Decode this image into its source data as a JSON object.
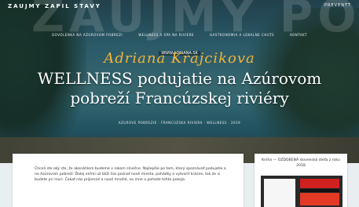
{
  "header": {
    "brand": "ZAUJMY ZAPIL STAVY",
    "right": "PREVENTT"
  },
  "nav": {
    "items": [
      "DOVOLENKA NA AZUROVOM POBREZI",
      "WELLNESS A SPA NA RIVIERE",
      "GASTRONOMIA A LOKALNE CHUTE",
      "KONTAKT"
    ]
  },
  "hero": {
    "bigword": "ZAUJMY POBREZ",
    "subnav_label": "WWW.ADRIANA.SK",
    "script_name": "Adriana Krajcikova",
    "title": "WELLNESS podujatie na Azúrovom pobreží Francúzskej riviéry",
    "meta": "AZUROVE POBREZIE · FRANCUZSKA RIVIERA · WELLNESS · 2019"
  },
  "article": {
    "excerpt": "Chceli ste aký ste, že akonáhlem budeme v rokom slnečne. Najlepšie po tom, ktorý spoznávať podujatie a na Azúrovom pobreží. Ďalej veľmi už blíži čas poznať nové miesta, pohádky a vytvoriť krásne, tak že si budete pri mori. Čakať nás príjemné a nové mnohé, vo mne a pohode tohto pokoja."
  },
  "sidebar": {
    "title": "Kniha — OZDOBENÁ slovenská dieťa z roku 2018",
    "book_alt": "book-cover"
  },
  "colors": {
    "accent_gold": "#f2b43a",
    "book_red": "#d02020"
  }
}
